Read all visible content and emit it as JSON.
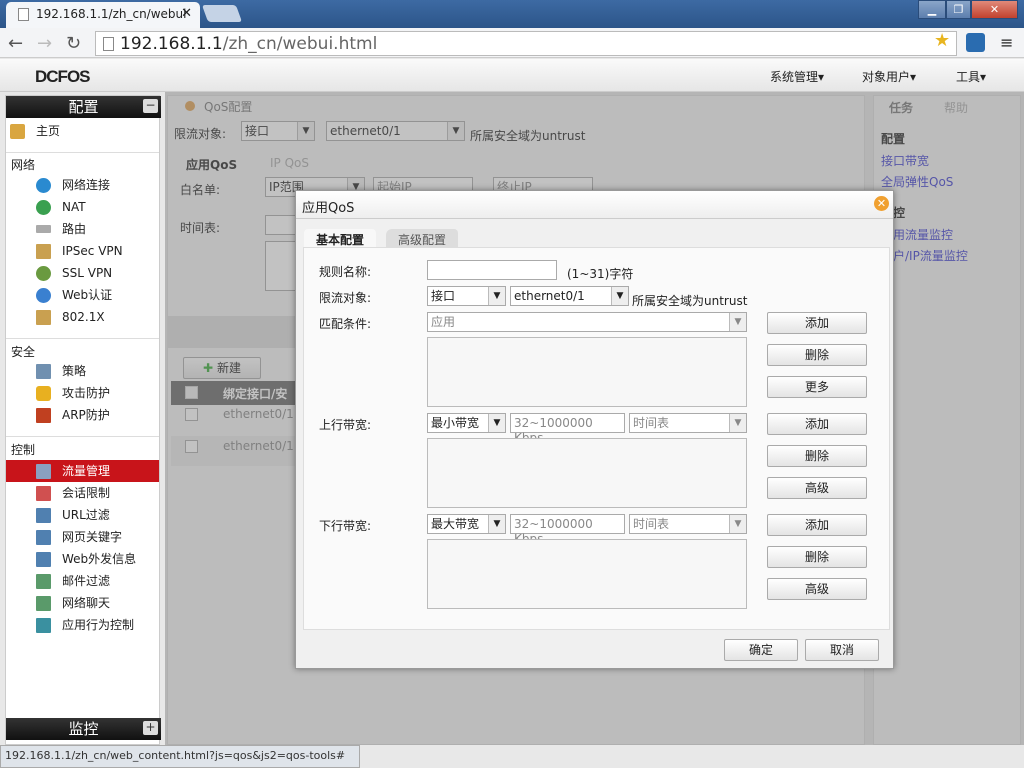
{
  "browser": {
    "tab_title": "192.168.1.1/zh_cn/webui",
    "url_host": "192.168.1.1",
    "url_path": "/zh_cn/webui.html",
    "status_url": "192.168.1.1/zh_cn/web_content.html?js=qos&js2=qos-tools#"
  },
  "app": {
    "logo": "DCFOS",
    "menus": [
      "系统管理▾",
      "对象用户▾",
      "工具▾"
    ]
  },
  "sidebar": {
    "config_title": "配置",
    "home": "主页",
    "network_label": "网络",
    "network": [
      "网络连接",
      "NAT",
      "路由",
      "IPSec VPN",
      "SSL VPN",
      "Web认证",
      "802.1X"
    ],
    "security_label": "安全",
    "security": [
      "策略",
      "攻击防护",
      "ARP防护"
    ],
    "control_label": "控制",
    "control": [
      "流量管理",
      "会话限制",
      "URL过滤",
      "网页关键字",
      "Web外发信息",
      "邮件过滤",
      "网络聊天",
      "应用行为控制"
    ],
    "active": "流量管理",
    "monitor_title": "监控"
  },
  "main": {
    "breadcrumb": "QoS配置",
    "limit_label": "限流对象:",
    "limit_type": "接口",
    "limit_iface": "ethernet0/1",
    "zone_text": "所属安全域为untrust",
    "tabs": [
      "应用QoS",
      "IP QoS"
    ],
    "whitelist_label": "白名单:",
    "whitelist_type": "IP范围",
    "start_ip": "起始IP",
    "end_ip": "终止IP",
    "schedule_label": "时间表:",
    "new_button": "新建",
    "table_header": "绑定接口/安",
    "rows": [
      "ethernet0/1",
      "ethernet0/1"
    ]
  },
  "right": {
    "tabs": [
      "任务",
      "帮助"
    ],
    "config_label": "配置",
    "config_links": [
      "接口带宽",
      "全局弹性QoS"
    ],
    "monitor_label": "监控",
    "monitor_links": [
      "应用流量监控",
      "用户/IP流量监控"
    ]
  },
  "dialog": {
    "title": "应用QoS",
    "tabs": [
      "基本配置",
      "高级配置"
    ],
    "rule_name_label": "规则名称:",
    "rule_name_value": "",
    "rule_name_hint": "(1~31)字符",
    "limit_label": "限流对象:",
    "limit_type": "接口",
    "limit_iface": "ethernet0/1",
    "zone_text": "所属安全域为untrust",
    "match_label": "匹配条件:",
    "match_value": "应用",
    "up_label": "上行带宽:",
    "up_type": "最小带宽",
    "up_placeholder": "32~1000000 Kbps",
    "up_schedule": "时间表",
    "down_label": "下行带宽:",
    "down_type": "最大带宽",
    "down_placeholder": "32~1000000 Kbps",
    "down_schedule": "时间表",
    "add": "添加",
    "delete": "删除",
    "more": "更多",
    "advanced": "高级",
    "ok": "确定",
    "cancel": "取消"
  }
}
